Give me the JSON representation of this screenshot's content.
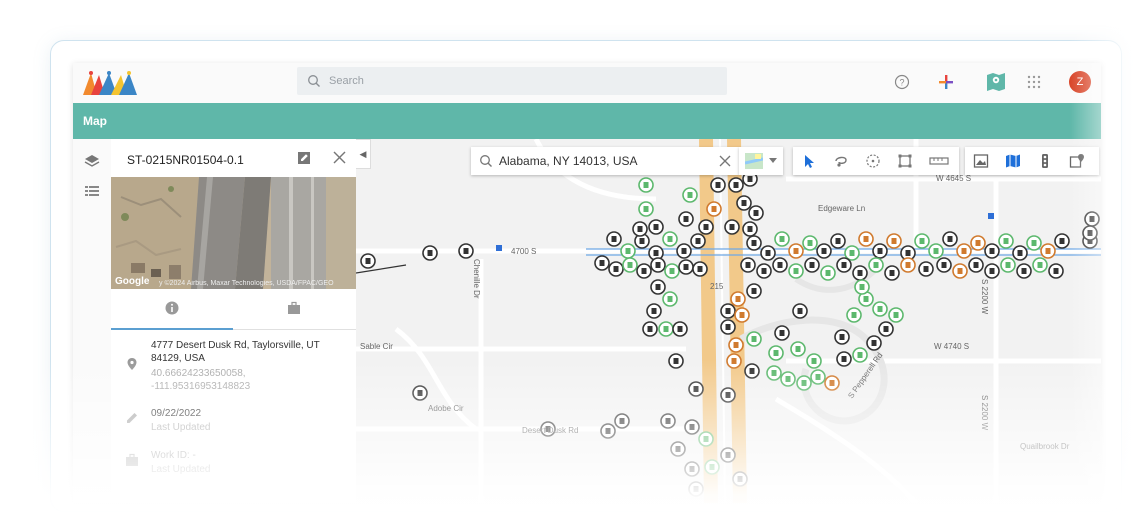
{
  "header": {
    "search_placeholder": "Search",
    "avatar_initial": "Z"
  },
  "titlebar": {
    "title": "Map"
  },
  "panel": {
    "feature_id": "ST-0215NR01504-0.1",
    "photo_attribution": "Google",
    "photo_credit": "y ©2024 Airbus, Maxar Technologies, USDA/FPAC/GEO",
    "address": "4777 Desert Dusk Rd, Taylorsville, UT 84129, USA",
    "lat": "40.66624233650058,",
    "lng": "-111.95316953148823",
    "date": "09/22/2022",
    "date_label": "Last Updated",
    "work_id": "Work ID: -",
    "work_label": "Last Updated"
  },
  "map": {
    "search_value": "Alabama, NY 14013, USA",
    "streets": {
      "w4645": "W 4645 S",
      "edgeware": "Edgeware Ln",
      "s4700": "4700 S",
      "chenille": "Chenille Dr",
      "sable": "Sable Cir",
      "w4740": "W 4740 S",
      "s2200a": "S 2200 W",
      "s2200b": "S 2200 W",
      "pepperell": "S Pepperell Rd",
      "adobe": "Adobe Cir",
      "desertdusk": "Desert Dusk Rd",
      "quailbrook": "Quailbrook Dr",
      "i215": "215"
    }
  },
  "colors": {
    "brand_green": "#5fb7a9",
    "accent_blue": "#5b9fd1",
    "road_orange": "#f2c98a",
    "marker_green": "#5cb86d",
    "marker_orange": "#d07a2e",
    "avatar_red": "#d9472b"
  }
}
